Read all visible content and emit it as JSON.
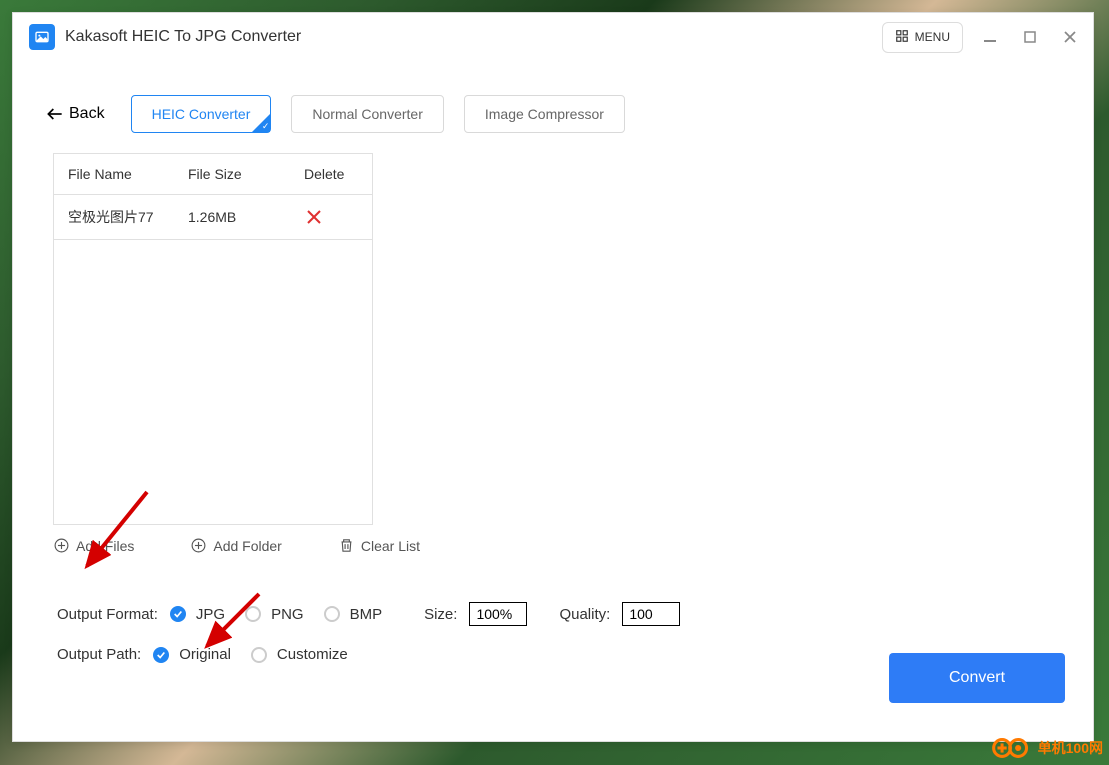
{
  "app": {
    "title": "Kakasoft HEIC To JPG Converter",
    "menu_label": "MENU"
  },
  "nav": {
    "back": "Back",
    "tabs": [
      {
        "label": "HEIC Converter",
        "active": true
      },
      {
        "label": "Normal Converter",
        "active": false
      },
      {
        "label": "Image Compressor",
        "active": false
      }
    ]
  },
  "file_table": {
    "headers": {
      "name": "File Name",
      "size": "File Size",
      "delete": "Delete"
    },
    "rows": [
      {
        "name": "空极光图片77",
        "size": "1.26MB"
      }
    ]
  },
  "actions": {
    "add_files": "Add Files",
    "add_folder": "Add Folder",
    "clear_list": "Clear List"
  },
  "output": {
    "format_label": "Output Format:",
    "formats": [
      "JPG",
      "PNG",
      "BMP"
    ],
    "format_selected": "JPG",
    "size_label": "Size:",
    "size_value": "100%",
    "quality_label": "Quality:",
    "quality_value": "100",
    "path_label": "Output Path:",
    "path_options": [
      "Original",
      "Customize"
    ],
    "path_selected": "Original"
  },
  "convert_label": "Convert",
  "watermark": {
    "brand": "单机100网"
  }
}
